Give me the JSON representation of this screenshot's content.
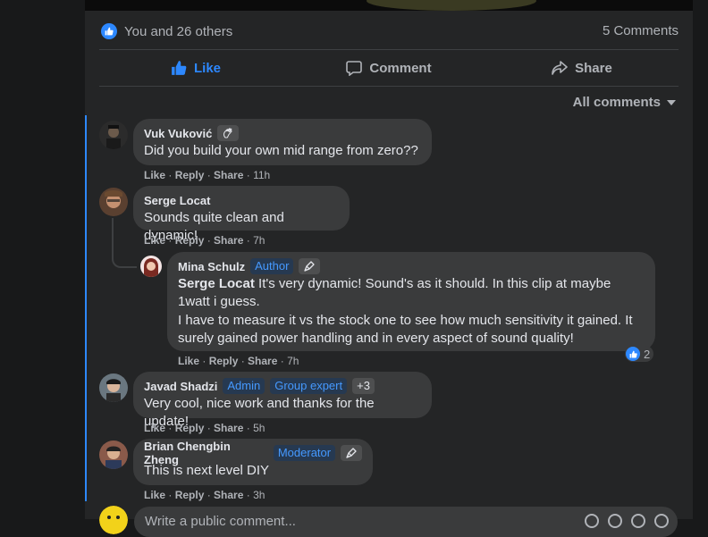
{
  "post": {
    "reactions_text": "You and 26 others",
    "comments_count": "5 Comments"
  },
  "actions": {
    "like": "Like",
    "comment": "Comment",
    "share": "Share"
  },
  "sort_label": "All comments",
  "comments": [
    {
      "name": "Vuk Vuković",
      "text": "Did you build your own mid range from zero??",
      "like": "Like",
      "reply": "Reply",
      "share": "Share",
      "time": "11h",
      "badge_icon": "waving-hand-icon"
    },
    {
      "name": "Serge Locat",
      "text": "Sounds quite clean and dynamic!",
      "like": "Like",
      "reply": "Reply",
      "share": "Share",
      "time": "7h"
    },
    {
      "name": "Mina Schulz",
      "badge": "Author",
      "badge_icon": "quill-pen-icon",
      "mention": "Serge Locat",
      "text": " It's very dynamic! Sound's as it should. In this clip at maybe 1watt i guess.",
      "text2": "I have to measure it vs the stock one to see how much sensitivity it gained. It surely gained power handling and in every aspect of sound quality!",
      "like": "Like",
      "reply": "Reply",
      "share": "Share",
      "time": "7h",
      "reaction_count": "2"
    },
    {
      "name": "Javad Shadzi",
      "badges": [
        "Admin",
        "Group expert",
        "+3"
      ],
      "text": "Very cool, nice work and thanks for the update!",
      "like": "Like",
      "reply": "Reply",
      "share": "Share",
      "time": "5h"
    },
    {
      "name": "Brian Chengbin Zheng",
      "badge": "Moderator",
      "badge_icon": "quill-pen-icon",
      "text": "This is next level DIY",
      "like": "Like",
      "reply": "Reply",
      "share": "Share",
      "time": "3h"
    }
  ],
  "composer": {
    "placeholder": "Write a public comment..."
  },
  "colors": {
    "accent": "#2d88ff",
    "bubble": "#3a3b3c",
    "card": "#242526",
    "page": "#18191a"
  }
}
